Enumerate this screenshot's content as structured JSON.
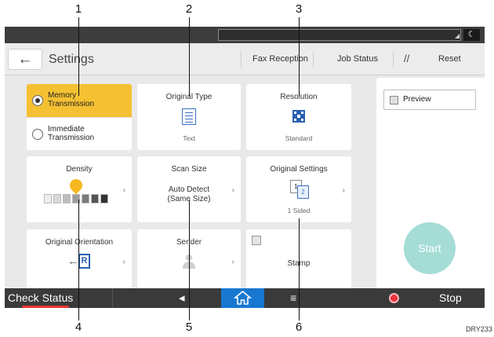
{
  "callouts": [
    "1",
    "2",
    "3",
    "4",
    "5",
    "6"
  ],
  "header": {
    "title": "Settings",
    "fax_reception": "Fax Reception",
    "job_status": "Job Status",
    "reset": "Reset"
  },
  "transmission": {
    "memory": "Memory\nTransmission",
    "immediate": "Immediate\nTransmission",
    "selected": "memory"
  },
  "tiles": {
    "original_type": {
      "label": "Original Type",
      "value": "Text"
    },
    "resolution": {
      "label": "Resolution",
      "value": "Standard"
    },
    "density": {
      "label": "Density",
      "level": 4,
      "max": 7
    },
    "scan_size": {
      "label": "Scan Size",
      "value": "Auto Detect\n(Same Size)"
    },
    "original_settings": {
      "label": "Original Settings",
      "value": "1 Sided"
    },
    "original_orientation": {
      "label": "Original Orientation"
    },
    "sender": {
      "label": "Sender"
    },
    "stamp": {
      "label": "Stamp"
    }
  },
  "side_panel": {
    "preview": "Preview",
    "start": "Start"
  },
  "bottom_bar": {
    "check_status": "Check Status",
    "stop": "Stop"
  },
  "colors": {
    "selected_tile": "#f5c132",
    "start_button": "#a5dcd6",
    "home_button": "#1877d0",
    "stop_icon": "#e8323c",
    "resolution_icon": "#2a5fb0"
  },
  "figure_code": "DRY233"
}
